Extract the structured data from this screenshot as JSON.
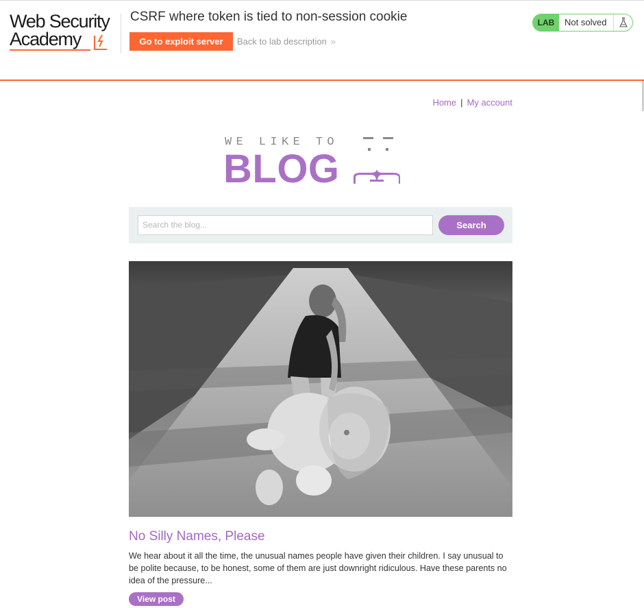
{
  "lab_header": {
    "logo_line1": "Web Security",
    "logo_line2": "Academy",
    "title": "CSRF where token is tied to non-session cookie",
    "exploit_button": "Go to exploit server",
    "back_link": "Back to lab description",
    "status_badge": "LAB",
    "status_text": "Not solved",
    "status_color": "#70d16d",
    "accent_color": "#ff6633"
  },
  "nav": {
    "home": "Home",
    "separator": "|",
    "my_account": "My account"
  },
  "blog_logo": {
    "tagline": "WE LIKE TO",
    "word": "BLOG",
    "color": "#a971c6"
  },
  "search": {
    "placeholder": "Search the blog...",
    "button": "Search"
  },
  "post": {
    "image_icon": "photo-girl-with-teddy-lion",
    "title": "No Silly Names, Please",
    "summary": "We hear about it all the time, the unusual names people have given their children. I say unusual to be polite because, to be honest, some of them are just downright ridiculous. Have these parents no idea of the pressure...",
    "view_button": "View post"
  }
}
